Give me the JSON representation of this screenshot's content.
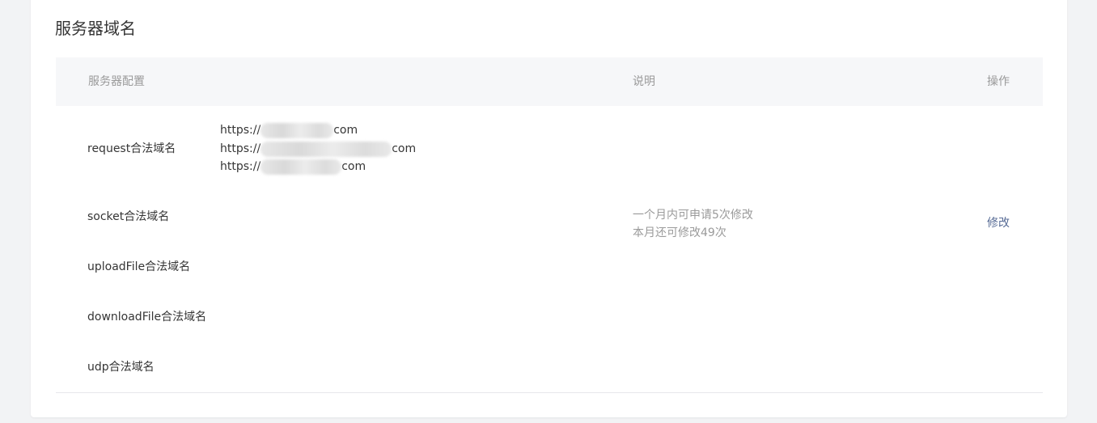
{
  "section": {
    "title": "服务器域名"
  },
  "table": {
    "headers": {
      "config": "服务器配置",
      "desc": "说明",
      "action": "操作"
    },
    "rows": [
      {
        "label": "request合法域名",
        "domains": [
          {
            "prefix": "https://",
            "suffix": "com"
          },
          {
            "prefix": "https://",
            "suffix": "com"
          },
          {
            "prefix": "https://",
            "suffix": "com"
          }
        ]
      },
      {
        "label": "socket合法域名"
      },
      {
        "label": "uploadFile合法域名"
      },
      {
        "label": "downloadFile合法域名"
      },
      {
        "label": "udp合法域名"
      }
    ],
    "description": {
      "line1": "一个月内可申请5次修改",
      "line2": "本月还可修改49次"
    },
    "action_label": "修改"
  },
  "colors": {
    "link": "#576b95",
    "muted_text": "#9a9a9a",
    "body_text": "#353535",
    "header_bg": "#f6f7f9",
    "page_bg": "#f2f3f5"
  }
}
